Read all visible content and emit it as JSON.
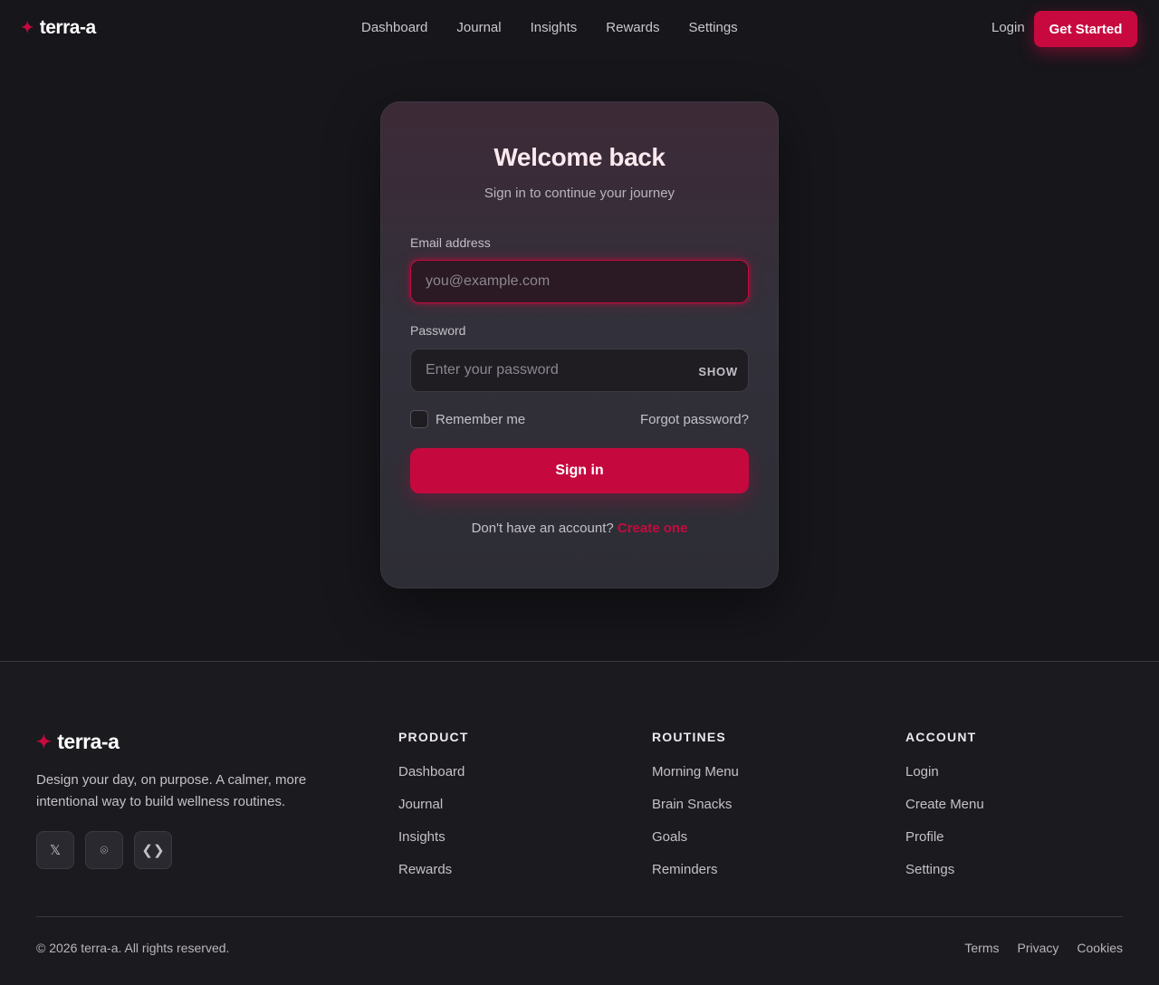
{
  "brand": {
    "name": "terra-a",
    "logo_icon": "sparkle-star-icon",
    "accent_color": "#c8093f"
  },
  "nav": {
    "links": [
      "Dashboard",
      "Journal",
      "Insights",
      "Rewards",
      "Settings"
    ],
    "login_label": "Login",
    "cta_label": "Get Started"
  },
  "login_card": {
    "title": "Welcome back",
    "subtitle": "Sign in to continue your journey",
    "email": {
      "label": "Email address",
      "placeholder": "you@example.com",
      "value": ""
    },
    "password": {
      "label": "Password",
      "placeholder": "Enter your password",
      "value": "",
      "toggle_label": "SHOW"
    },
    "remember_label": "Remember me",
    "remember_checked": false,
    "forgot_label": "Forgot password?",
    "submit_label": "Sign in",
    "signup_prompt": "Don't have an account?",
    "signup_link": "Create one"
  },
  "footer": {
    "tagline": "Design your day, on purpose. A calmer, more intentional way to build wellness routines.",
    "socials": [
      {
        "icon": "x-twitter-icon",
        "glyph": "𝕏"
      },
      {
        "icon": "instagram-icon",
        "glyph": "⌾"
      },
      {
        "icon": "code-icon",
        "glyph": "❮❯"
      }
    ],
    "columns": [
      {
        "title": "PRODUCT",
        "links": [
          "Dashboard",
          "Journal",
          "Insights",
          "Rewards"
        ]
      },
      {
        "title": "ROUTINES",
        "links": [
          "Morning Menu",
          "Brain Snacks",
          "Goals",
          "Reminders"
        ]
      },
      {
        "title": "ACCOUNT",
        "links": [
          "Login",
          "Create Menu",
          "Profile",
          "Settings"
        ]
      }
    ],
    "copyright": "© 2026 terra-a. All rights reserved.",
    "legal_links": [
      "Terms",
      "Privacy",
      "Cookies"
    ]
  }
}
